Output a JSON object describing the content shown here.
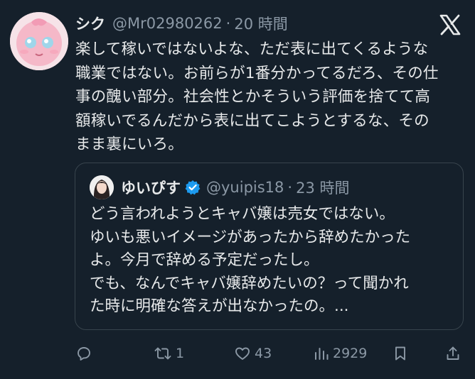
{
  "tweet": {
    "display_name": "シク",
    "handle": "@Mr02980262",
    "separator": "·",
    "time": "20 時間",
    "text_lines": [
      "楽して稼いではないよな、ただ表に出てくるような",
      "職業ではない。お前らが1番分かってるだろ、その仕",
      "事の醜い部分。社会性とかそういう評価を捨てて高",
      "額稼いでるんだから表に出てこようとするな、その",
      "まま裏にいろ。"
    ]
  },
  "quote": {
    "display_name": "ゆいぴす",
    "handle": "@yuipis18",
    "separator": "·",
    "time": "23 時間",
    "text_lines": [
      "どう言われようとキャバ嬢は売女ではない。",
      "ゆいも悪いイメージがあったから辞めたかった",
      "よ。今月で辞める予定だったし。",
      "でも、なんでキャバ嬢辞めたいの？って聞かれ",
      "た時に明確な答えが出なかったの。..."
    ]
  },
  "actions": {
    "reply_count": "",
    "retweet_count": "1",
    "like_count": "43",
    "view_count": "2929"
  },
  "colors": {
    "background": "#15202b",
    "text": "#e7e9ea",
    "secondary": "#8b98a5",
    "border": "#38444d",
    "verified": "#1d9bf0"
  },
  "icons": {
    "logo": "x-logo",
    "verified": "verified-badge-icon",
    "reply": "reply-icon",
    "retweet": "retweet-icon",
    "like": "heart-icon",
    "views": "views-icon",
    "bookmark": "bookmark-icon",
    "share": "share-icon"
  }
}
